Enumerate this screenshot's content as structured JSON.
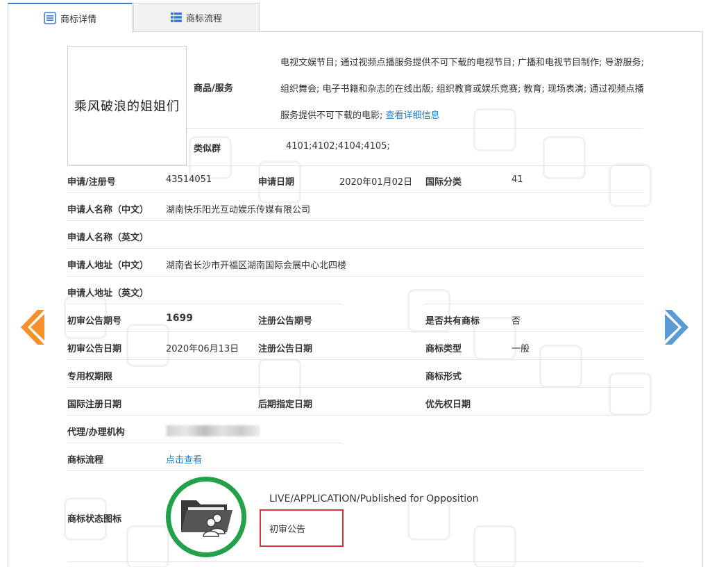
{
  "tabs": [
    {
      "label": "商标详情",
      "active": true
    },
    {
      "label": "商标流程",
      "active": false
    }
  ],
  "trademark_name": "乘风破浪的姐姐们",
  "goods": {
    "label": "商品/服务",
    "text": "电视文娱节目; 通过视频点播服务提供不可下载的电视节目; 广播和电视节目制作; 导游服务; 组织舞会; 电子书籍和杂志的在线出版; 组织教育或娱乐竞赛; 教育; 现场表演; 通过视频点播服务提供不可下载的电影;",
    "more_link": "查看详细信息"
  },
  "similar_group": {
    "label": "类似群",
    "value": "4101;4102;4104;4105;"
  },
  "fields": {
    "reg_no": {
      "label": "申请/注册号",
      "value": "43514051"
    },
    "apply_date": {
      "label": "申请日期",
      "value": "2020年01月02日"
    },
    "intl_class": {
      "label": "国际分类",
      "value": "41"
    },
    "applicant_cn": {
      "label": "申请人名称（中文）",
      "value": "湖南快乐阳光互动娱乐传媒有限公司"
    },
    "applicant_en": {
      "label": "申请人名称（英文）",
      "value": ""
    },
    "address_cn": {
      "label": "申请人地址（中文）",
      "value": "湖南省长沙市开福区湖南国际会展中心北四楼"
    },
    "address_en": {
      "label": "申请人地址（英文）",
      "value": ""
    },
    "prelim_issue": {
      "label": "初审公告期号",
      "value": "1699"
    },
    "reg_issue": {
      "label": "注册公告期号",
      "value": ""
    },
    "shared": {
      "label": "是否共有商标",
      "value": "否"
    },
    "prelim_date": {
      "label": "初审公告日期",
      "value": "2020年06月13日"
    },
    "reg_date": {
      "label": "注册公告日期",
      "value": ""
    },
    "mark_type": {
      "label": "商标类型",
      "value": "一般"
    },
    "exclusive_period": {
      "label": "专用权期限",
      "value": ""
    },
    "mark_form": {
      "label": "商标形式",
      "value": ""
    },
    "intl_reg_date": {
      "label": "国际注册日期",
      "value": ""
    },
    "later_designation": {
      "label": "后期指定日期",
      "value": ""
    },
    "priority_date": {
      "label": "优先权日期",
      "value": ""
    },
    "agent": {
      "label": "代理/办理机构",
      "value": ""
    },
    "process": {
      "label": "商标流程",
      "link": "点击查看"
    },
    "status_icon": {
      "label": "商标状态图标"
    }
  },
  "status": {
    "english": "LIVE/APPLICATION/Published for Opposition",
    "chinese": "初审公告",
    "circle_color": "#22a04a",
    "highlight_color": "#d9363e"
  },
  "colors": {
    "accent": "#3a7bd5",
    "prev_arrow": "#f5902a",
    "next_arrow": "#5b9bd5",
    "link": "#1e7fc8"
  },
  "icons": {
    "tab1": "list-detail-icon",
    "tab2": "list-icon",
    "prev": "arrow-left-icon",
    "next": "arrow-right-icon",
    "status": "folder-users-icon"
  }
}
